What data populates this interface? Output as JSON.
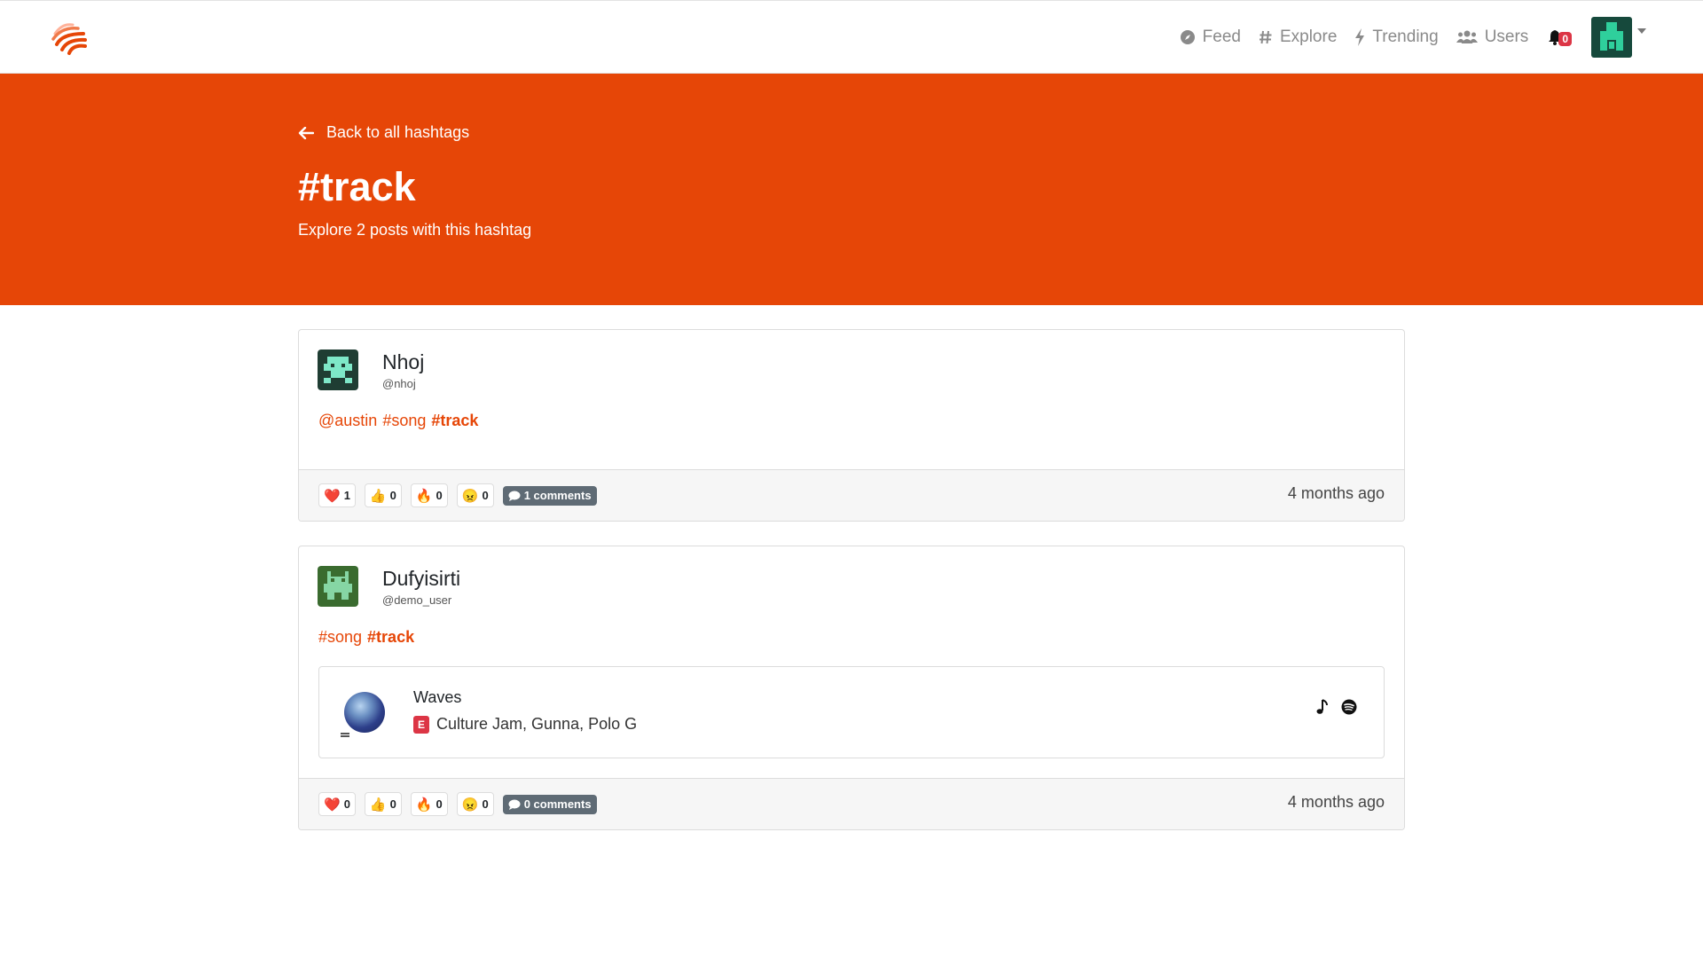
{
  "nav": {
    "feed": "Feed",
    "explore": "Explore",
    "trending": "Trending",
    "users": "Users",
    "notifications_count": "0"
  },
  "hero": {
    "back_label": "Back to all hashtags",
    "title": "#track",
    "subtitle": "Explore 2 posts with this hashtag"
  },
  "posts": [
    {
      "name": "Nhoj",
      "handle": "@nhoj",
      "tokens": [
        "@austin",
        "#song",
        "#track"
      ],
      "reactions": {
        "heart": "1",
        "thumbs": "0",
        "fire": "0",
        "angry": "0"
      },
      "comments_label": "1 comments",
      "time": "4 months ago"
    },
    {
      "name": "Dufyisirti",
      "handle": "@demo_user",
      "tokens": [
        "#song",
        "#track"
      ],
      "track": {
        "title": "Waves",
        "explicit": "E",
        "artists": "Culture Jam, Gunna, Polo G"
      },
      "reactions": {
        "heart": "0",
        "thumbs": "0",
        "fire": "0",
        "angry": "0"
      },
      "comments_label": "0 comments",
      "time": "4 months ago"
    }
  ],
  "colors": {
    "brand": "#e64607",
    "badge": "#dc3545",
    "comments_badge": "#5f6b75"
  },
  "icons": {
    "feed": "compass-icon",
    "explore": "hash-icon",
    "trending": "bolt-icon",
    "users": "users-icon",
    "notifications": "bell-icon",
    "back": "arrow-left-icon",
    "comments": "comment-icon",
    "music": "music-note-icon",
    "spotify": "spotify-icon"
  }
}
